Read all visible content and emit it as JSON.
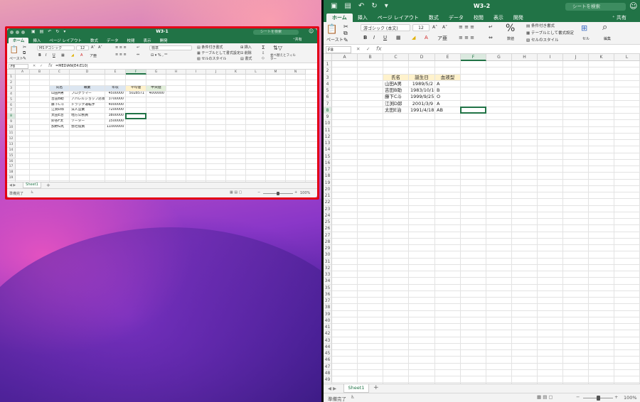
{
  "windowA": {
    "title": "W3-1",
    "search_placeholder": "シートを検索",
    "share": "共有",
    "tabs": [
      "ホーム",
      "挿入",
      "ページ レイアウト",
      "数式",
      "データ",
      "校閲",
      "表示",
      "開発"
    ],
    "ribbon": {
      "paste": "ペースト",
      "font": "MS Pゴシック",
      "size": "12",
      "number_format": "標準",
      "cond_format": "条件付き書式",
      "table_format": "テーブルとして書式設定",
      "cell_style": "セルのスタイル",
      "insert": "挿入",
      "delete": "削除",
      "format": "書式",
      "sort_filter": "並べ替えとフィルター"
    },
    "name_box": "F8",
    "formula": "=MEDIAN(E4:E10)",
    "columns": [
      "A",
      "B",
      "C",
      "D",
      "E",
      "F",
      "G",
      "H",
      "I",
      "J",
      "K",
      "L",
      "M",
      "N"
    ],
    "rows": [
      "1",
      "2",
      "3",
      "4",
      "5",
      "6",
      "7",
      "8",
      "9",
      "10",
      "11",
      "12",
      "13",
      "14",
      "15",
      "16",
      "17",
      "18",
      "19"
    ],
    "headers": [
      "氏名",
      "職業",
      "年収",
      "平均値",
      "中央値"
    ],
    "data": [
      [
        "山田A男",
        "プログラマー",
        "4500000",
        "5028571",
        "4000000"
      ],
      [
        "吉田B助",
        "アパレルショップ店長",
        "3700000",
        "",
        ""
      ],
      [
        "藤下C斗",
        "トラック運転手",
        "4000000",
        "",
        ""
      ],
      [
        "江渕D郎",
        "法人営業",
        "7200000",
        "",
        ""
      ],
      [
        "太田E治",
        "地方公務員",
        "3800000",
        "",
        ""
      ],
      [
        "鈴谷F太",
        "ソーター",
        "1500000",
        "",
        ""
      ],
      [
        "加野G丸",
        "会社役員",
        "11000000",
        "",
        ""
      ]
    ],
    "sheet_tab": "Sheet1",
    "status": "準備完了",
    "zoom": "100%"
  },
  "windowB": {
    "title": "W3-2",
    "search_placeholder": "シートを検索",
    "share": "共有",
    "tabs": [
      "ホーム",
      "挿入",
      "ページ レイアウト",
      "数式",
      "データ",
      "校閲",
      "表示",
      "開発"
    ],
    "ribbon": {
      "paste": "ペースト",
      "font": "游ゴシック (本文)",
      "size": "12",
      "number": "数値",
      "cond_format": "条件付き書式",
      "table_format": "テーブルとして書式設定",
      "cell_style": "セルのスタイル",
      "cell": "セル",
      "edit": "編集"
    },
    "name_box": "F8",
    "formula": "",
    "columns": [
      "A",
      "B",
      "C",
      "D",
      "E",
      "F",
      "G",
      "H",
      "I",
      "J",
      "K",
      "L"
    ],
    "rows": [
      "1",
      "2",
      "3",
      "4",
      "5",
      "6",
      "7",
      "8",
      "9",
      "10",
      "11",
      "12",
      "13",
      "14",
      "15",
      "16",
      "17",
      "18",
      "19",
      "20",
      "21",
      "22",
      "23",
      "24",
      "25",
      "26",
      "27",
      "28",
      "29",
      "30",
      "31",
      "32",
      "33",
      "34",
      "35",
      "36",
      "37",
      "38",
      "39",
      "40",
      "41",
      "42",
      "43",
      "44",
      "45",
      "46",
      "47",
      "48",
      "49"
    ],
    "headers": [
      "氏名",
      "誕生日",
      "血液型"
    ],
    "data": [
      [
        "山田A男",
        "1989/5/2",
        "A"
      ],
      [
        "吉田B助",
        "1983/10/16",
        "B"
      ],
      [
        "藤下C斗",
        "1999/9/25",
        "O"
      ],
      [
        "江渕D郎",
        "2001/3/9",
        "A"
      ],
      [
        "太田E治",
        "1991/4/18",
        "AB"
      ]
    ],
    "sheet_tab": "Sheet1",
    "status": "準備完了",
    "zoom": "100%"
  },
  "colors": {
    "excel_green": "#217346",
    "header_fill": "#dce6f1",
    "avg_fill": "#fff2cc",
    "highlight_frame": "#e30016"
  }
}
